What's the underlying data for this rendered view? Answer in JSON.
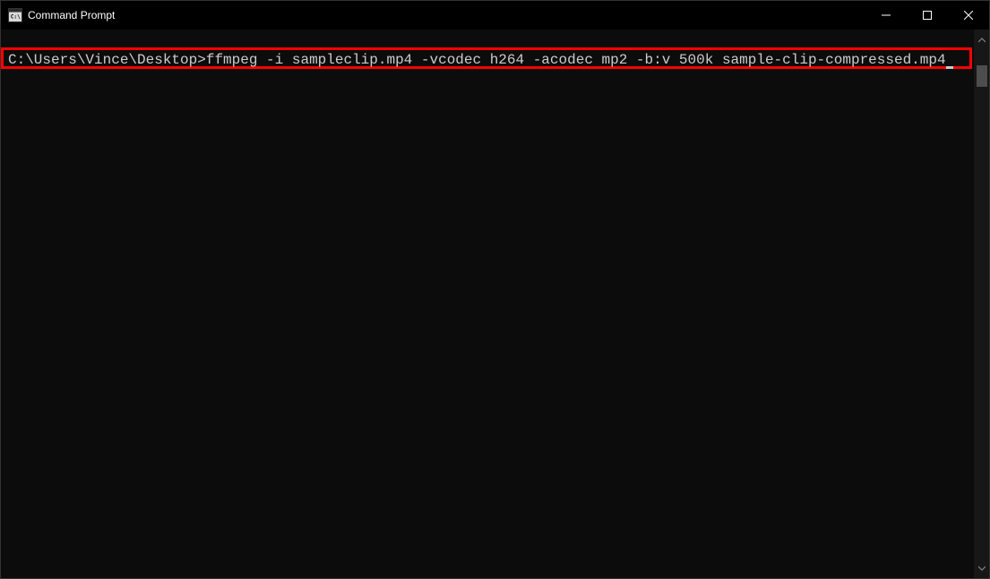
{
  "window": {
    "title": "Command Prompt",
    "icon_label": "C:\\"
  },
  "terminal": {
    "prompt": "C:\\Users\\Vince\\Desktop>",
    "command": "ffmpeg -i sampleclip.mp4 -vcodec h264 -acodec mp2 -b:v 500k sample-clip-compressed.mp4"
  }
}
